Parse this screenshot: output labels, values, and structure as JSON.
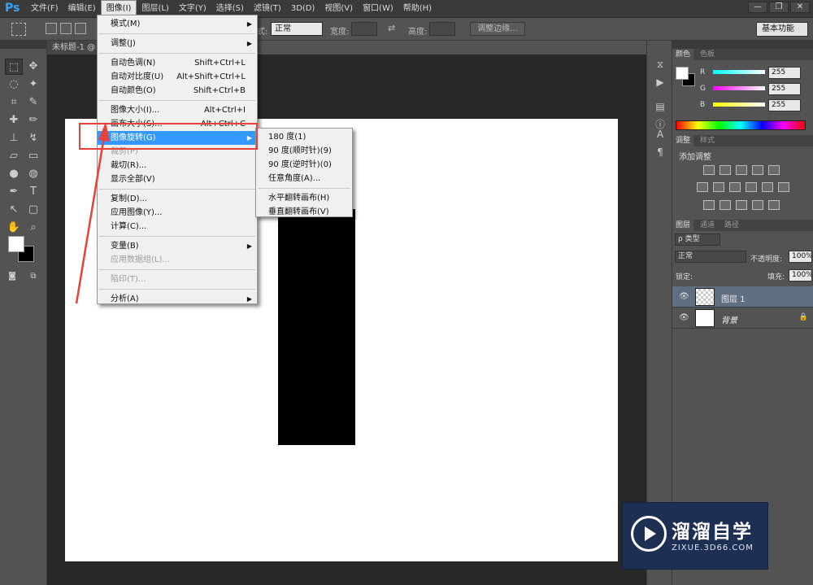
{
  "app": {
    "logo": "Ps"
  },
  "menubar": {
    "items": [
      "文件(F)",
      "编辑(E)",
      "图像(I)",
      "图层(L)",
      "文字(Y)",
      "选择(S)",
      "滤镜(T)",
      "3D(D)",
      "视图(V)",
      "窗口(W)",
      "帮助(H)"
    ],
    "active_index": 2,
    "window_controls": [
      "—",
      "❐",
      "✕"
    ]
  },
  "optionsbar": {
    "style_label": "式:",
    "style_value": "正常",
    "width_label": "宽度:",
    "height_label": "高度:",
    "refine_edge": "调整边缘...",
    "workspace": "基本功能"
  },
  "document": {
    "tab_title": "未标题-1 @"
  },
  "image_menu": {
    "items": [
      {
        "label": "模式(M)",
        "shortcut": "",
        "submenu": true,
        "disabled": false
      },
      {
        "sep": true
      },
      {
        "label": "调整(J)",
        "shortcut": "",
        "submenu": true,
        "disabled": false
      },
      {
        "sep": true
      },
      {
        "label": "自动色调(N)",
        "shortcut": "Shift+Ctrl+L",
        "submenu": false,
        "disabled": false
      },
      {
        "label": "自动对比度(U)",
        "shortcut": "Alt+Shift+Ctrl+L",
        "submenu": false,
        "disabled": false
      },
      {
        "label": "自动颜色(O)",
        "shortcut": "Shift+Ctrl+B",
        "submenu": false,
        "disabled": false
      },
      {
        "sep": true
      },
      {
        "label": "图像大小(I)...",
        "shortcut": "Alt+Ctrl+I",
        "submenu": false,
        "disabled": false
      },
      {
        "label": "画布大小(S)...",
        "shortcut": "Alt+Ctrl+C",
        "submenu": false,
        "disabled": false
      },
      {
        "label": "图像旋转(G)",
        "shortcut": "",
        "submenu": true,
        "disabled": false,
        "highlighted": true
      },
      {
        "label": "裁剪(P)",
        "shortcut": "",
        "submenu": false,
        "disabled": true
      },
      {
        "label": "裁切(R)...",
        "shortcut": "",
        "submenu": false,
        "disabled": false
      },
      {
        "label": "显示全部(V)",
        "shortcut": "",
        "submenu": false,
        "disabled": false
      },
      {
        "sep": true
      },
      {
        "label": "复制(D)...",
        "shortcut": "",
        "submenu": false,
        "disabled": false
      },
      {
        "label": "应用图像(Y)...",
        "shortcut": "",
        "submenu": false,
        "disabled": false
      },
      {
        "label": "计算(C)...",
        "shortcut": "",
        "submenu": false,
        "disabled": false
      },
      {
        "sep": true
      },
      {
        "label": "变量(B)",
        "shortcut": "",
        "submenu": true,
        "disabled": false
      },
      {
        "label": "应用数据组(L)...",
        "shortcut": "",
        "submenu": false,
        "disabled": true
      },
      {
        "sep": true
      },
      {
        "label": "陷印(T)...",
        "shortcut": "",
        "submenu": false,
        "disabled": true
      },
      {
        "sep": true
      },
      {
        "label": "分析(A)",
        "shortcut": "",
        "submenu": true,
        "disabled": false
      }
    ]
  },
  "rotate_submenu": {
    "items": [
      {
        "label": "180 度(1)"
      },
      {
        "label": "90 度(顺时针)(9)"
      },
      {
        "label": "90 度(逆时针)(0)"
      },
      {
        "label": "任意角度(A)..."
      },
      {
        "sep": true
      },
      {
        "label": "水平翻转画布(H)"
      },
      {
        "label": "垂直翻转画布(V)"
      }
    ]
  },
  "color_panel": {
    "tabs": [
      "颜色",
      "色板"
    ],
    "channels": [
      {
        "name": "R",
        "value": "255"
      },
      {
        "name": "G",
        "value": "255"
      },
      {
        "name": "B",
        "value": "255"
      }
    ]
  },
  "adjust_panel": {
    "tabs": [
      "调整",
      "样式"
    ],
    "title": "添加调整"
  },
  "layers_panel": {
    "tabs": [
      "图层",
      "通道",
      "路径"
    ],
    "filter": "ρ 类型",
    "blend_mode": "正常",
    "opacity_label": "不透明度:",
    "opacity_value": "100%",
    "lock_label": "锁定:",
    "fill_label": "填充:",
    "fill_value": "100%",
    "layers": [
      {
        "name": "图层 1",
        "selected": true
      },
      {
        "name": "背景",
        "selected": false
      }
    ]
  },
  "watermark": {
    "title": "溜溜自学",
    "url": "ZIXUE.3D66.COM"
  },
  "colors": {
    "highlight": "#3399ff",
    "annotation": "#e8413a",
    "watermark_bg": "#1e2f54"
  }
}
